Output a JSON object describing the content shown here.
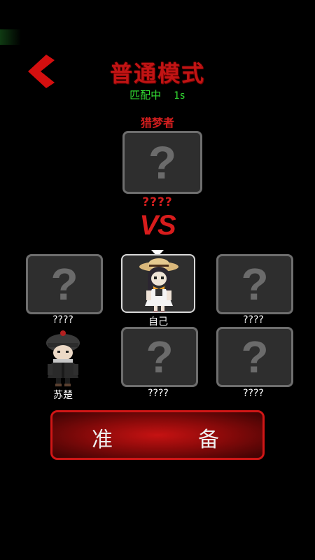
{
  "header": {
    "title": "普通模式"
  },
  "matching": {
    "label": "匹配中",
    "timer": "1s"
  },
  "hunter": {
    "label": "猎梦者",
    "name": "????",
    "slot_glyph": "?"
  },
  "vs": "VS",
  "players": [
    {
      "name": "????",
      "glyph": "?"
    },
    {
      "name": "自己"
    },
    {
      "name": "????",
      "glyph": "?"
    },
    {
      "name": "苏楚"
    },
    {
      "name": "????",
      "glyph": "?"
    },
    {
      "name": "????",
      "glyph": "?"
    }
  ],
  "ready_button": {
    "char1": "准",
    "char2": "备"
  },
  "colors": {
    "accent_red": "#c11414",
    "match_green": "#33dd33",
    "slot_bg": "#2e2e2e"
  },
  "icons": {
    "back": "chevron-left-icon"
  }
}
